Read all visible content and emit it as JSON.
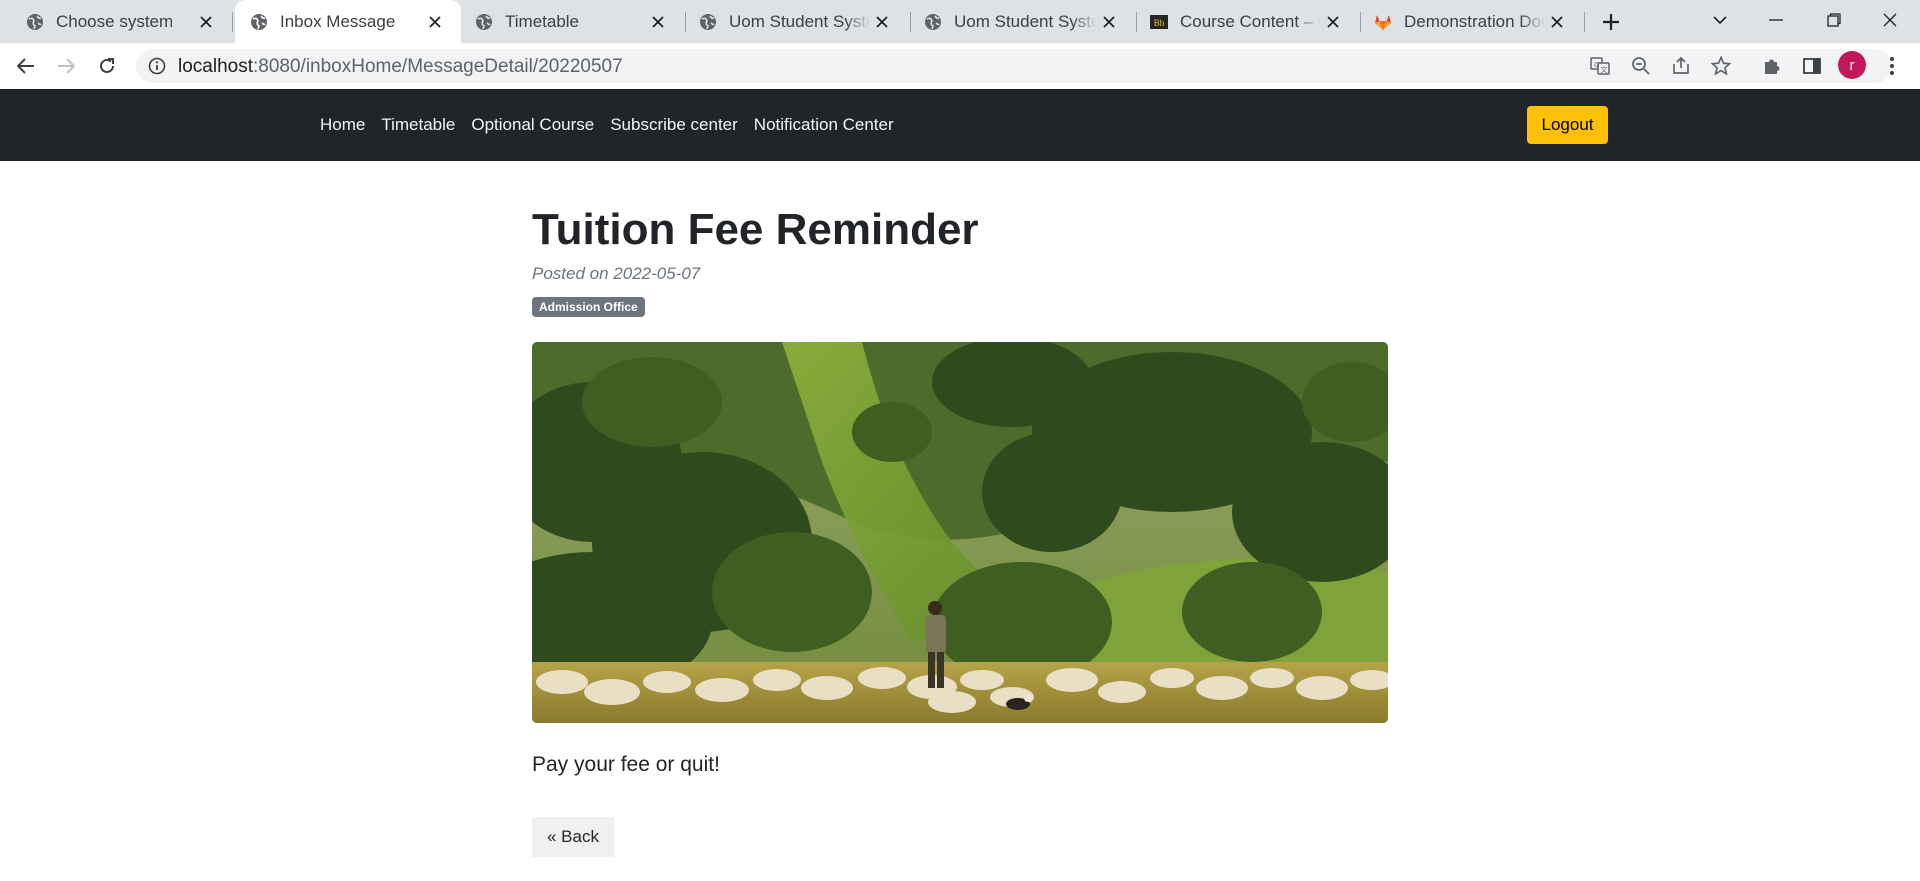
{
  "browser": {
    "tabs": [
      {
        "title": "Choose system",
        "icon": "globe-icon"
      },
      {
        "title": "Inbox Message",
        "icon": "globe-icon"
      },
      {
        "title": "Timetable",
        "icon": "globe-icon"
      },
      {
        "title": "Uom Student System",
        "icon": "globe-icon"
      },
      {
        "title": "Uom Student System",
        "icon": "globe-icon"
      },
      {
        "title": "Course Content – C",
        "icon": "blackboard-icon"
      },
      {
        "title": "Demonstration Doc",
        "icon": "gitlab-icon"
      }
    ],
    "active_tab_index": 1,
    "url": {
      "host": "localhost",
      "rest": ":8080/inboxHome/MessageDetail/20220507"
    },
    "profile_initial": "r",
    "profile_color": "#c2185b"
  },
  "navbar": {
    "links": [
      "Home",
      "Timetable",
      "Optional Course",
      "Subscribe center",
      "Notification Center"
    ],
    "logout_label": "Logout",
    "logout_color": "#ffc107",
    "background": "#212529"
  },
  "message": {
    "title": "Tuition Fee Reminder",
    "posted": "Posted on 2022-05-07",
    "badge": "Admission Office",
    "body": "Pay your fee or quit!",
    "back_label": "« Back"
  }
}
